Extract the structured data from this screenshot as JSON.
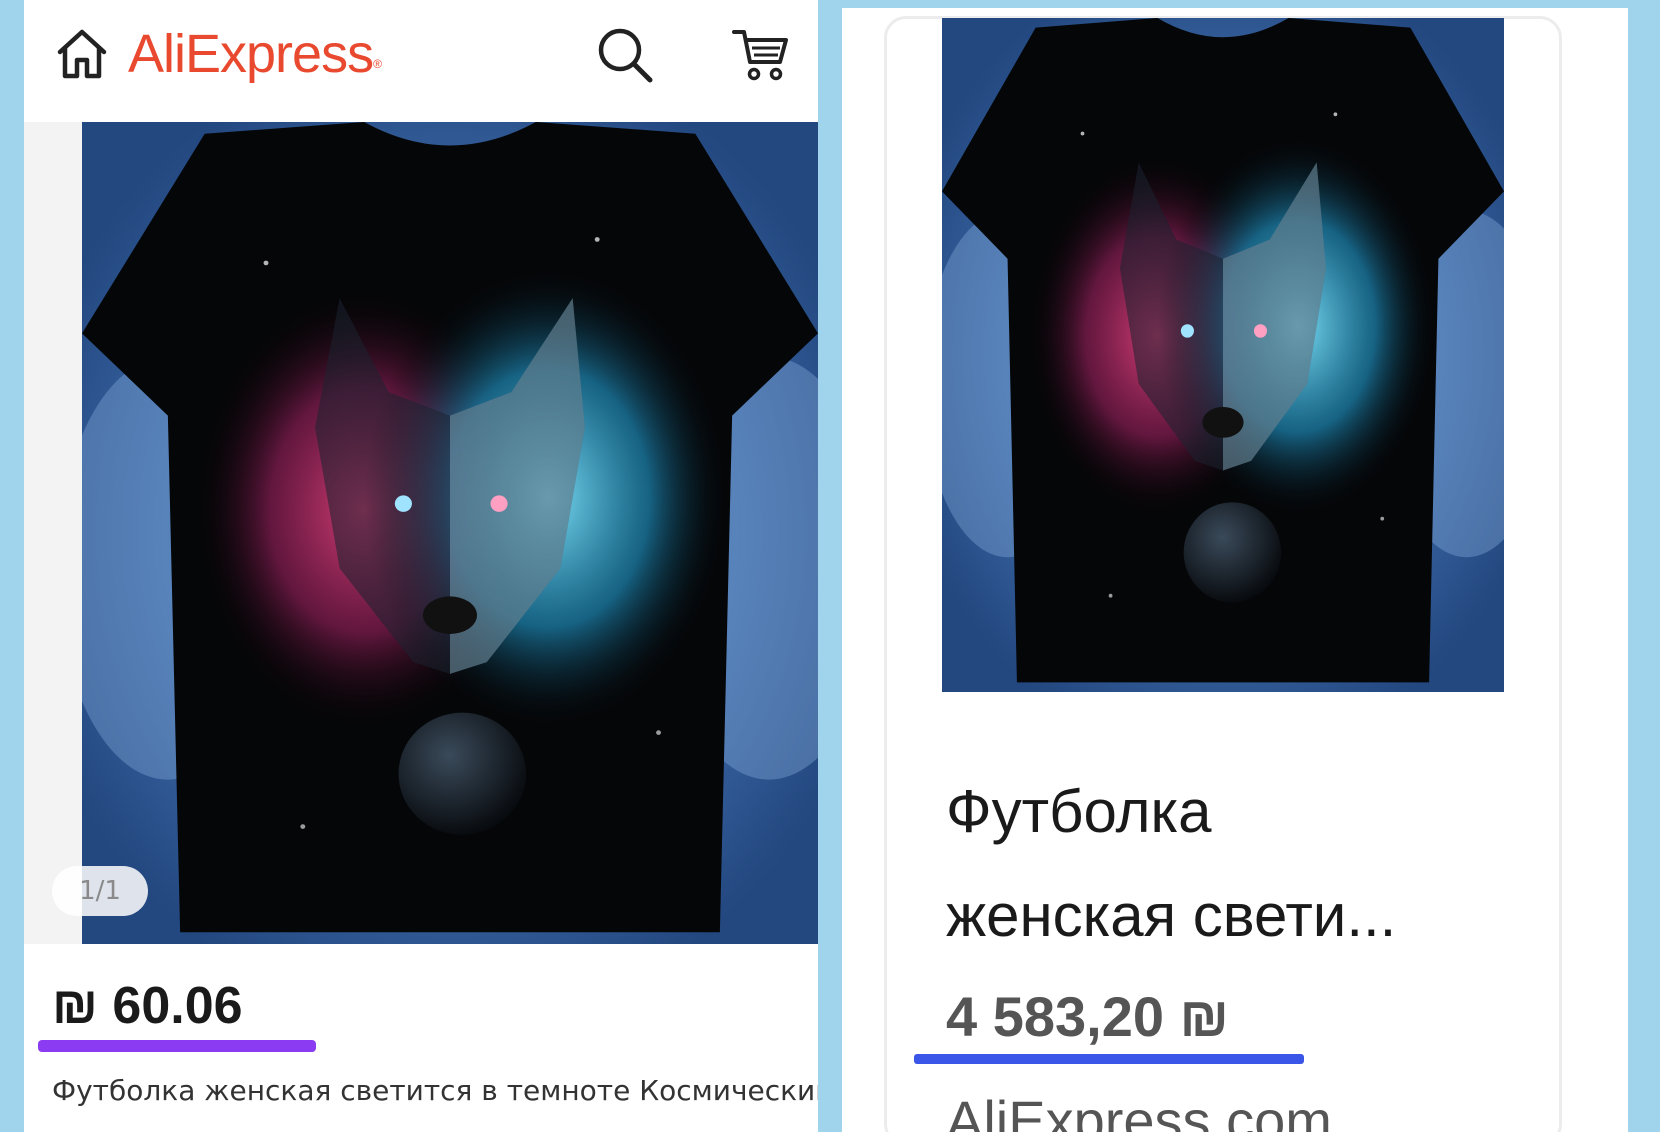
{
  "left_panel": {
    "header": {
      "logo_text": "AliExpress",
      "logo_mark": "®",
      "icons": [
        "home-icon",
        "search-icon",
        "cart-icon"
      ],
      "brand_color": "#e8492f"
    },
    "gallery": {
      "counter": "1/1",
      "image": "wolf-galaxy-tshirt-image"
    },
    "price": "₪ 60.06",
    "price_underline_color": "#8b3cf2",
    "title": "Футболка женская светится в темноте Космический"
  },
  "right_panel": {
    "image": "wolf-galaxy-tshirt-image",
    "title_lines": [
      "Футболка",
      "женская свети..."
    ],
    "price": "4 583,20 ₪",
    "price_underline_color": "#3a56e8",
    "domain": "AliExpress.com"
  }
}
